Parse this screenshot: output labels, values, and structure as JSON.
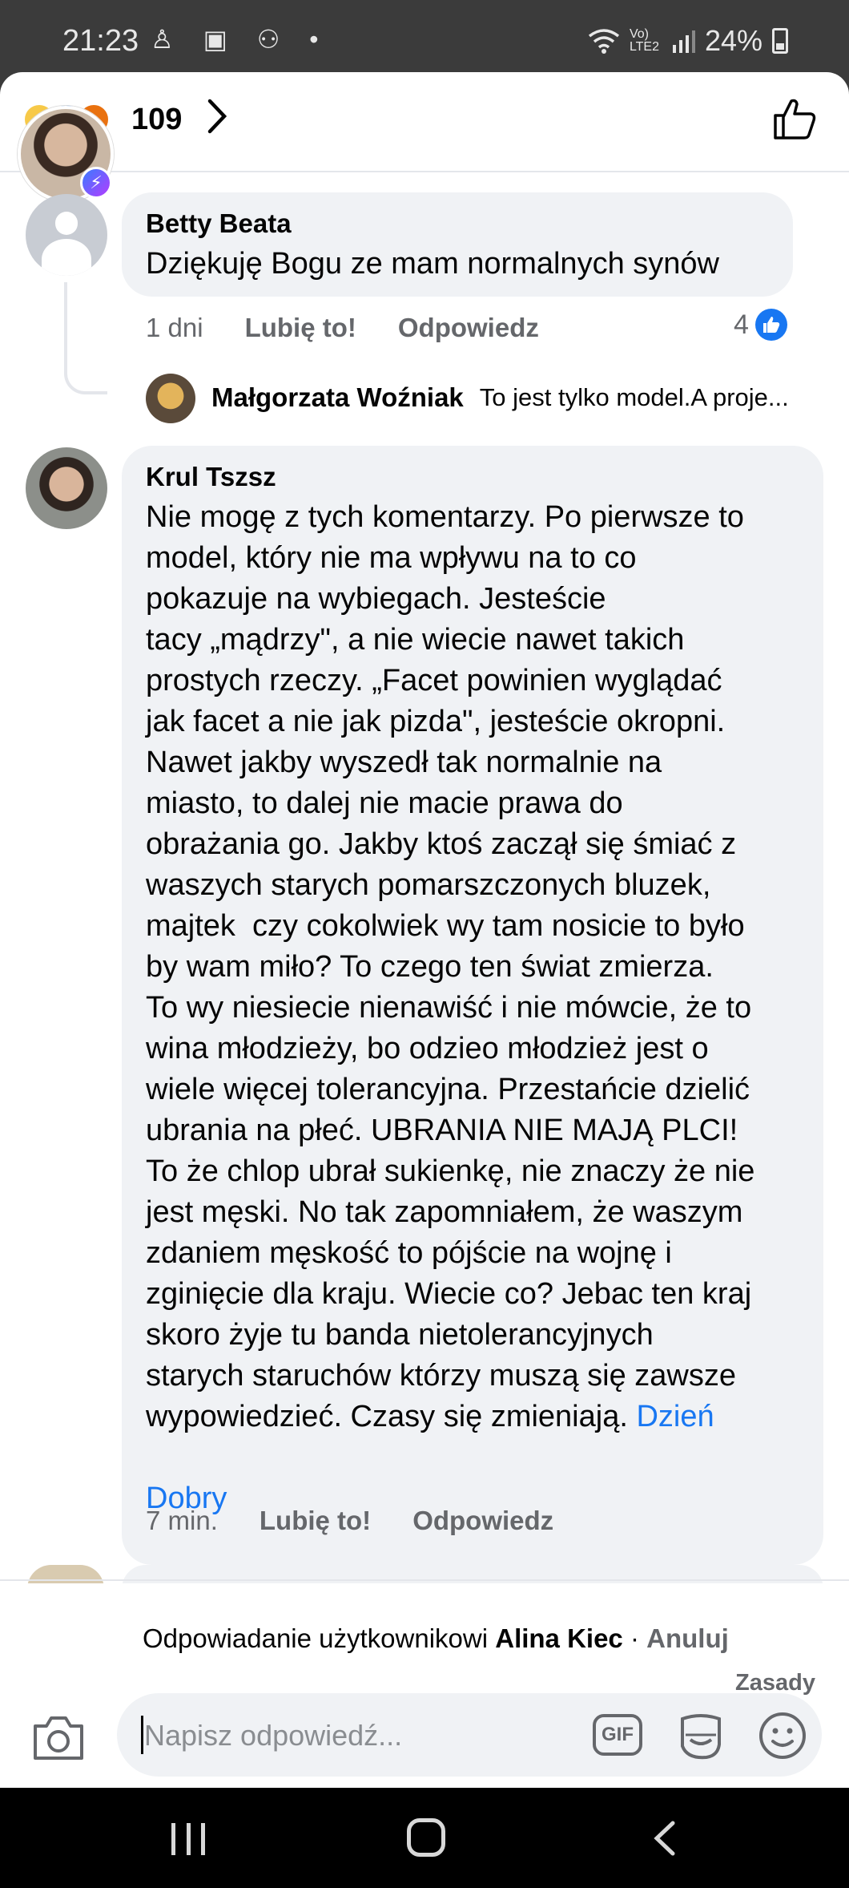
{
  "status_bar": {
    "time": "21:23",
    "left_icons": "♙ ▣ ⚇ •",
    "signal_text": "Vo) LTE2",
    "battery": "24%"
  },
  "header": {
    "reactions_count": "109"
  },
  "comments": [
    {
      "author": "Betty Beata",
      "text": "Dziękuję Bogu ze mam normalnych synów",
      "age": "1 dni",
      "like_label": "Lubię to!",
      "reply_label": "Odpowiedz",
      "like_count": "4"
    },
    {
      "author": "Krul Tszsz",
      "text_lines": [
        "Nie mogę z tych komentarzy. Po pierwsze to",
        "model, który nie ma wpływu na to co",
        "pokazuje na wybiegach. Jesteście",
        "tacy „mądrzy\", a nie wiecie nawet takich",
        "prostych rzeczy. „Facet powinien wyglądać",
        "jak facet a nie jak pizda\", jesteście okropni.",
        "Nawet jakby wyszedł tak normalnie na",
        "miasto, to dalej nie macie prawa do",
        "obrażania go. Jakby ktoś zaczął się śmiać z",
        "waszych starych pomarszczonych bluzek,",
        "majtek  czy cokolwiek wy tam nosicie to było",
        "by wam miło? To czego ten świat zmierza.",
        "To wy niesiecie nienawiść i nie mówcie, że to",
        "wina młodzieży, bo odzieo młodzież jest o",
        "wiele więcej tolerancyjna. Przestańcie dzielić",
        "ubrania na płeć. UBRANIA NIE MAJĄ PLCI!",
        "To że chlop ubrał sukienkę, nie znaczy że nie",
        "jest męski. No tak zapomniałem, że waszym",
        "zdaniem męskość to pójście na wojnę i",
        "zginięcie dla kraju. Wiecie co? Jebac ten kraj",
        "skoro żyje tu banda nietolerancyjnych",
        "starych staruchów którzy muszą się zawsze",
        "wypowiedzieć. Czasy się zmieniają."
      ],
      "link_part1": "Dzień",
      "link_part2": "Dobry",
      "age": "7 min.",
      "like_label": "Lubię to!",
      "reply_label": "Odpowiedz"
    }
  ],
  "reply_preview": {
    "author": "Małgorzata Woźniak",
    "snippet": "To jest tylko model.A proje..."
  },
  "composer": {
    "replying_prefix": "Odpowiadanie użytkownikowi",
    "replying_to": "Alina Kiec",
    "separator": " · ",
    "cancel_label": "Anuluj",
    "rules_label": "Zasady",
    "placeholder": "Napisz odpowiedź...",
    "gif_label": "GIF"
  },
  "colors": {
    "accent": "#1877f2",
    "bubble": "#f0f2f5",
    "secondary_text": "#65676b"
  }
}
